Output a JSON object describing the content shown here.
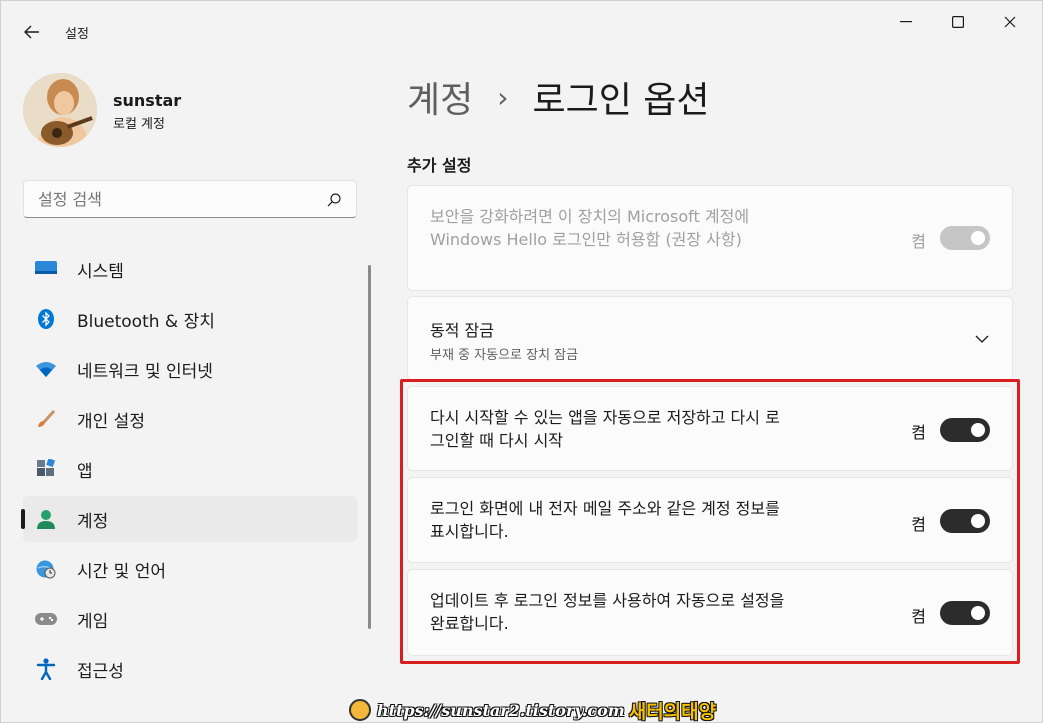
{
  "window": {
    "title": "설정",
    "back_icon": "arrow-left-icon",
    "controls": [
      "minimize-icon",
      "maximize-icon",
      "close-icon"
    ]
  },
  "profile": {
    "name": "sunstar",
    "account_type": "로컬 계정"
  },
  "search": {
    "placeholder": "설정 검색"
  },
  "sidebar": {
    "items": [
      {
        "label": "시스템",
        "icon": "system-icon",
        "color": "#0067c0"
      },
      {
        "label": "Bluetooth & 장치",
        "icon": "bluetooth-icon",
        "color": "#0078d4"
      },
      {
        "label": "네트워크 및 인터넷",
        "icon": "wifi-icon",
        "color": "#0078d4"
      },
      {
        "label": "개인 설정",
        "icon": "brush-icon",
        "color": "#e07b39"
      },
      {
        "label": "앱",
        "icon": "apps-icon",
        "color": "#4a5a6a"
      },
      {
        "label": "계정",
        "icon": "account-icon",
        "color": "#28a06a",
        "selected": true
      },
      {
        "label": "시간 및 언어",
        "icon": "globe-clock-icon",
        "color": "#0078d4"
      },
      {
        "label": "게임",
        "icon": "gamepad-icon",
        "color": "#7a7a7a"
      },
      {
        "label": "접근성",
        "icon": "accessibility-icon",
        "color": "#0067c0"
      }
    ]
  },
  "main": {
    "breadcrumb_parent": "계정",
    "breadcrumb_sep": "›",
    "breadcrumb_current": "로그인 옵션",
    "section_title": "추가 설정",
    "cards": [
      {
        "text": "보안을 강화하려면 이 장치의 Microsoft 계정에 Windows Hello 로그인만 허용함 (권장 사항)",
        "state_label": "켬",
        "toggle_on": true,
        "disabled": true
      },
      {
        "title": "동적 잠금",
        "subtitle": "부재 중 자동으로 장치 잠금",
        "expand_icon": "chevron-down-icon"
      },
      {
        "text": "다시 시작할 수 있는 앱을 자동으로 저장하고 다시 로그인할 때 다시 시작",
        "state_label": "켬",
        "toggle_on": true
      },
      {
        "text": "로그인 화면에 내 전자 메일 주소와 같은 계정 정보를 표시합니다.",
        "state_label": "켬",
        "toggle_on": true
      },
      {
        "text": "업데이트 후 로그인 정보를 사용하여 자동으로 설정을 완료합니다.",
        "state_label": "켬",
        "toggle_on": true
      }
    ]
  },
  "watermark": {
    "url": "https://sunstar2.tistory.com",
    "name": "새터의태양"
  },
  "colors": {
    "background": "#f3f3f3",
    "card": "#fbfbfb",
    "toggle_on": "#2c2c2c",
    "highlight_border": "#d81e1e"
  }
}
